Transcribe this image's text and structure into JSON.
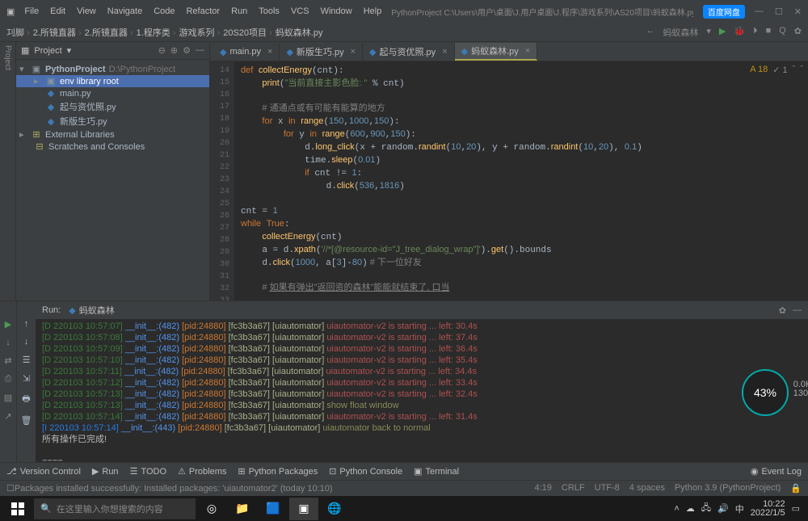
{
  "title": {
    "menus": [
      "File",
      "Edit",
      "View",
      "Navigate",
      "Code",
      "Refactor",
      "Run",
      "Tools",
      "VCS",
      "Window",
      "Help"
    ],
    "path": "PythonProject  C:\\Users\\用户\\桌面\\J.用户桌面\\J.程序\\游戏系列\\AS20项目\\蚂蚁森林.py",
    "cloud": "百度网盘"
  },
  "breadcrumbs": [
    "㓚脚",
    "2.所镜直器",
    "2.所镜直器",
    "1.程序类",
    "游戏系列",
    "20S20项目",
    "蚂蚁森林.py"
  ],
  "toolbar": {
    "run_config": "蚂蚁森林"
  },
  "project": {
    "header": "Project",
    "root": {
      "name": "PythonProject",
      "path": "D:\\PythonProject"
    },
    "folder_sel": "env  library root",
    "files": [
      "main.py",
      "起与资优照.py",
      "新版生巧.py"
    ],
    "ext_lib": "External Libraries",
    "scratch": "Scratches and Consoles"
  },
  "tabs": [
    {
      "label": "main.py",
      "active": false
    },
    {
      "label": "新版生巧.py",
      "active": false
    },
    {
      "label": "起与资优照.py",
      "active": false
    },
    {
      "label": "蚂蚁森林.py",
      "active": true
    }
  ],
  "indicators": {
    "warn": "A 18",
    "err": "✓ 1"
  },
  "code_lines_start": 14,
  "run": {
    "title": "蚂蚁森林",
    "final": "所有操作已完成!"
  },
  "bottom_tabs": [
    "Version Control",
    "Run",
    "TODO",
    "Problems",
    "Python Packages",
    "Python Console",
    "Terminal"
  ],
  "bottom_right": "Event Log",
  "status": {
    "msg": "Packages installed successfully: Installed packages: 'uiautomator2' (today 10:10)",
    "right": [
      "4:19",
      "CRLF",
      "UTF-8",
      "4 spaces",
      "Python 3.9 (PythonProject)"
    ]
  },
  "taskbar": {
    "search_placeholder": "在这里输入你想搜索的内容",
    "time": "10:22",
    "date": "2022/1/5"
  },
  "gauge": {
    "pct": "43%",
    "up": "0.0K/s",
    "dn": "130K/s"
  },
  "console_lines": [
    {
      "t": "[D 220103 10:57:07]",
      "m": "__init__:(482)",
      "p": "[pid:24880]",
      "g": "[fc3b3a67]",
      "x": "[uiautomator]",
      "s": "uiautomator-v2 is starting ... left: 30.4s"
    },
    {
      "t": "[D 220103 10:57:08]",
      "m": "__init__:(482)",
      "p": "[pid:24880]",
      "g": "[fc3b3a67]",
      "x": "[uiautomator]",
      "s": "uiautomator-v2 is starting ... left: 37.4s"
    },
    {
      "t": "[D 220103 10:57:09]",
      "m": "__init__:(482)",
      "p": "[pid:24880]",
      "g": "[fc3b3a67]",
      "x": "[uiautomator]",
      "s": "uiautomator-v2 is starting ... left: 36.4s"
    },
    {
      "t": "[D 220103 10:57:10]",
      "m": "__init__:(482)",
      "p": "[pid:24880]",
      "g": "[fc3b3a67]",
      "x": "[uiautomator]",
      "s": "uiautomator-v2 is starting ... left: 35.4s"
    },
    {
      "t": "[D 220103 10:57:11]",
      "m": "__init__:(482)",
      "p": "[pid:24880]",
      "g": "[fc3b3a67]",
      "x": "[uiautomator]",
      "s": "uiautomator-v2 is starting ... left: 34.4s"
    },
    {
      "t": "[D 220103 10:57:12]",
      "m": "__init__:(482)",
      "p": "[pid:24880]",
      "g": "[fc3b3a67]",
      "x": "[uiautomator]",
      "s": "uiautomator-v2 is starting ... left: 33.4s"
    },
    {
      "t": "[D 220103 10:57:13]",
      "m": "__init__:(482)",
      "p": "[pid:24880]",
      "g": "[fc3b3a67]",
      "x": "[uiautomator]",
      "s": "uiautomator-v2 is starting ... left: 32.4s"
    },
    {
      "t": "[D 220103 10:57:13]",
      "m": "__init__:(482)",
      "p": "[pid:24880]",
      "g": "[fc3b3a67]",
      "x": "[uiautomator]",
      "s2": "show float window"
    },
    {
      "t": "[D 220103 10:57:14]",
      "m": "__init__:(482)",
      "p": "[pid:24880]",
      "g": "[fc3b3a67]",
      "x": "[uiautomator]",
      "s": "uiautomator-v2 is starting ... left: 31.4s"
    },
    {
      "t": "[I 220103 10:57:14]",
      "m": "__init__:(443)",
      "p": "[pid:24880]",
      "g": "[fc3b3a67]",
      "x": "[uiautomator]",
      "i": "uiautomator back to normal"
    }
  ]
}
